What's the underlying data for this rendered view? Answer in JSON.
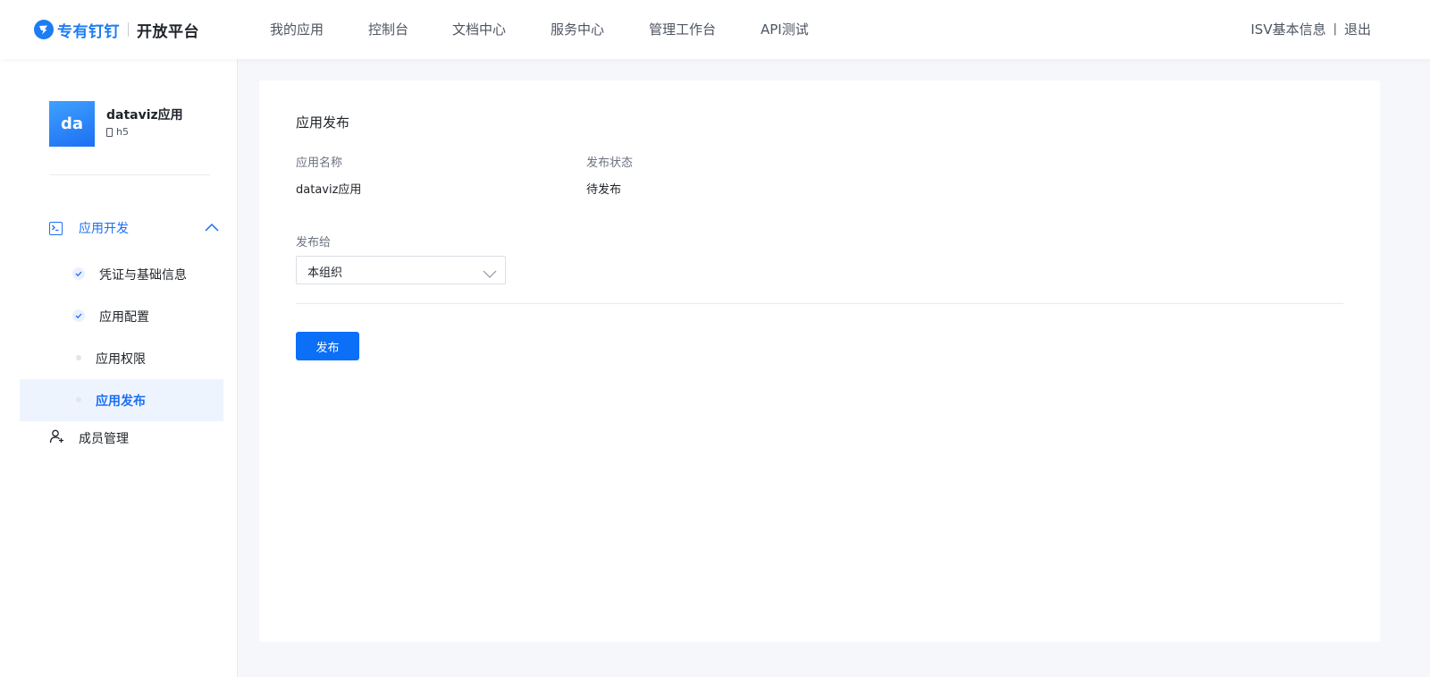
{
  "header": {
    "brand": "专有钉钉",
    "platform": "开放平台",
    "nav": [
      {
        "label": "我的应用"
      },
      {
        "label": "控制台"
      },
      {
        "label": "文档中心"
      },
      {
        "label": "服务中心"
      },
      {
        "label": "管理工作台"
      },
      {
        "label": "API测试"
      }
    ],
    "isv_info": "ISV基本信息",
    "separator": "|",
    "logout": "退出"
  },
  "sidebar": {
    "app": {
      "avatar_text": "da",
      "name": "dataviz应用",
      "type": "h5"
    },
    "dev_group": {
      "label": "应用开发",
      "items": [
        {
          "label": "凭证与基础信息",
          "status": "done"
        },
        {
          "label": "应用配置",
          "status": "done"
        },
        {
          "label": "应用权限",
          "status": "pending"
        },
        {
          "label": "应用发布",
          "status": "active"
        }
      ]
    },
    "member": {
      "label": "成员管理"
    }
  },
  "main": {
    "title": "应用发布",
    "app_name_label": "应用名称",
    "app_name_value": "dataviz应用",
    "status_label": "发布状态",
    "status_value": "待发布",
    "publish_to_label": "发布给",
    "publish_to_value": "本组织",
    "publish_button": "发布"
  },
  "colors": {
    "accent": "#1c6ff2",
    "button": "#0b6ff8",
    "active_bg": "#eef4fe"
  }
}
